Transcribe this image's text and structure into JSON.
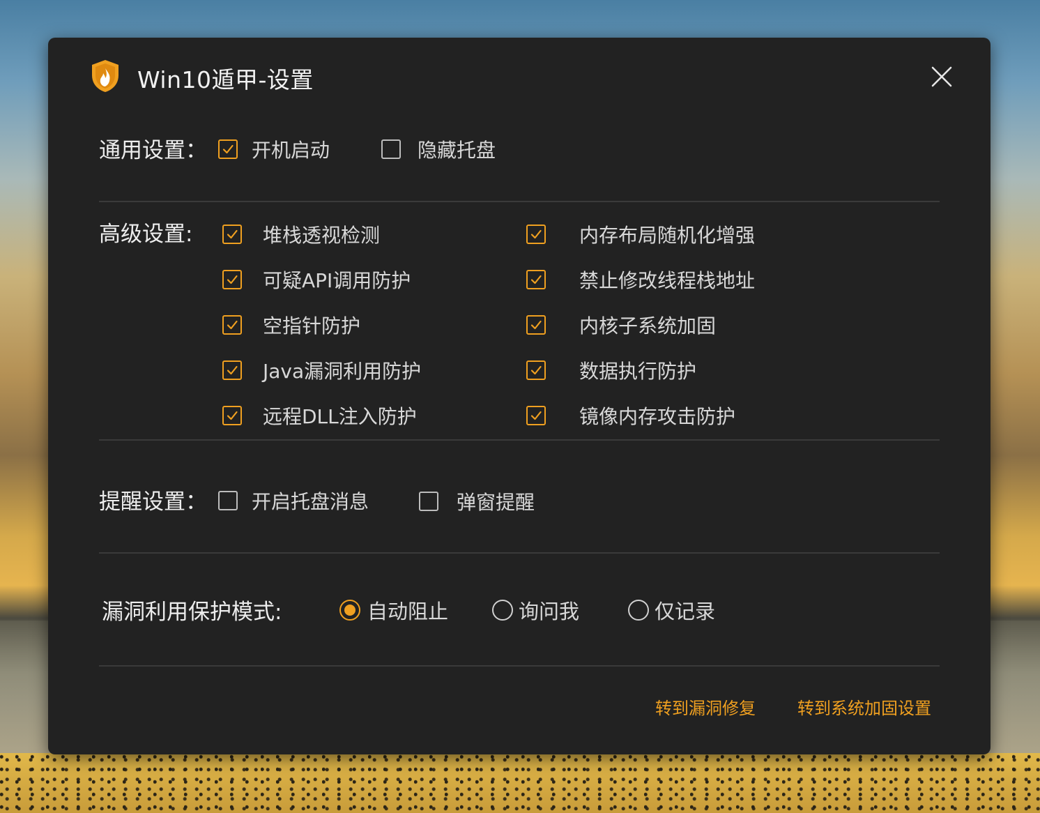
{
  "window": {
    "title": "Win10遁甲-设置",
    "accent_color": "#f0a020",
    "icon": "shield-flame-icon"
  },
  "general": {
    "label": "通用设置：",
    "options": [
      {
        "label": "开机启动",
        "checked": true
      },
      {
        "label": "隐藏托盘",
        "checked": false
      }
    ]
  },
  "advanced": {
    "label": "高级设置:",
    "left": [
      {
        "label": "堆栈透视检测",
        "checked": true
      },
      {
        "label": "可疑API调用防护",
        "checked": true
      },
      {
        "label": "空指针防护",
        "checked": true
      },
      {
        "label": "Java漏洞利用防护",
        "checked": true
      },
      {
        "label": "远程DLL注入防护",
        "checked": true
      }
    ],
    "right": [
      {
        "label": "内存布局随机化增强",
        "checked": true
      },
      {
        "label": "禁止修改线程栈地址",
        "checked": true
      },
      {
        "label": "内核子系统加固",
        "checked": true
      },
      {
        "label": "数据执行防护",
        "checked": true
      },
      {
        "label": "镜像内存攻击防护",
        "checked": true
      }
    ]
  },
  "notify": {
    "label": "提醒设置：",
    "options": [
      {
        "label": "开启托盘消息",
        "checked": false
      },
      {
        "label": "弹窗提醒",
        "checked": false
      }
    ]
  },
  "mode": {
    "label": "漏洞利用保护模式:",
    "options": [
      {
        "label": "自动阻止",
        "selected": true
      },
      {
        "label": "询问我",
        "selected": false
      },
      {
        "label": "仅记录",
        "selected": false
      }
    ]
  },
  "footer": {
    "link_vuln_fix": "转到漏洞修复",
    "link_hardening": "转到系统加固设置"
  }
}
